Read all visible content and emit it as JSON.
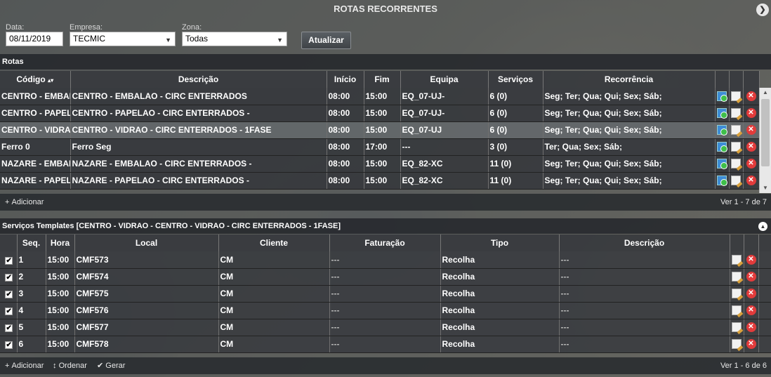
{
  "title": "ROTAS RECORRENTES",
  "filters": {
    "date_label": "Data:",
    "date_value": "08/11/2019",
    "company_label": "Empresa:",
    "company_value": "TECMIC",
    "zone_label": "Zona:",
    "zone_value": "Todas",
    "update_button": "Atualizar"
  },
  "routes": {
    "section_title": "Rotas",
    "columns": [
      "Código",
      "Descrição",
      "Início",
      "Fim",
      "Equipa",
      "Serviços",
      "Recorrência"
    ],
    "sort_indicator": "▴▾",
    "rows": [
      {
        "code": "CENTRO - EMBALAO",
        "desc": "CENTRO - EMBALAO - CIRC ENTERRADOS",
        "start": "08:00",
        "end": "15:00",
        "team": "EQ_07-UJ-",
        "services": "6 (0)",
        "recurrence": "Seg; Ter; Qua; Qui; Sex; Sáb;"
      },
      {
        "code": "CENTRO - PAPELAO",
        "desc": "CENTRO - PAPELAO - CIRC ENTERRADOS -",
        "start": "08:00",
        "end": "15:00",
        "team": "EQ_07-UJ-",
        "services": "6 (0)",
        "recurrence": "Seg; Ter; Qua; Qui; Sex; Sáb;"
      },
      {
        "code": "CENTRO - VIDRAO",
        "desc": "CENTRO - VIDRAO - CIRC ENTERRADOS - 1FASE",
        "start": "08:00",
        "end": "15:00",
        "team": "EQ_07-UJ",
        "services": "6 (0)",
        "recurrence": "Seg; Ter; Qua; Qui; Sex; Sáb;"
      },
      {
        "code": "Ferro 0",
        "desc": "Ferro Seg",
        "start": "08:00",
        "end": "17:00",
        "team": "---",
        "services": "3 (0)",
        "recurrence": "Ter; Qua; Sex; Sáb;"
      },
      {
        "code": "NAZARE - EMBALAO",
        "desc": "NAZARE - EMBALAO - CIRC ENTERRADOS -",
        "start": "08:00",
        "end": "15:00",
        "team": "EQ_82-XC",
        "services": "11 (0)",
        "recurrence": "Seg; Ter; Qua; Qui; Sex; Sáb;"
      },
      {
        "code": "NAZARE - PAPELAO",
        "desc": "NAZARE - PAPELAO - CIRC ENTERRADOS -",
        "start": "08:00",
        "end": "15:00",
        "team": "EQ_82-XC",
        "services": "11 (0)",
        "recurrence": "Seg; Ter; Qua; Qui; Sex; Sáb;"
      }
    ],
    "footer_add": "Adicionar",
    "pager": "Ver 1 - 7 de 7"
  },
  "services": {
    "section_title": "Serviços Templates [CENTRO - VIDRAO - CENTRO - VIDRAO - CIRC ENTERRADOS - 1FASE]",
    "columns": [
      "Seq.",
      "Hora",
      "Local",
      "Cliente",
      "Faturação",
      "Tipo",
      "Descrição"
    ],
    "rows": [
      {
        "seq": "1",
        "time": "15:00",
        "local": "CMF573",
        "client": "CM",
        "billing": "---",
        "type": "Recolha",
        "desc": "---"
      },
      {
        "seq": "2",
        "time": "15:00",
        "local": "CMF574",
        "client": "CM",
        "billing": "---",
        "type": "Recolha",
        "desc": "---"
      },
      {
        "seq": "3",
        "time": "15:00",
        "local": "CMF575",
        "client": "CM",
        "billing": "---",
        "type": "Recolha",
        "desc": "---"
      },
      {
        "seq": "4",
        "time": "15:00",
        "local": "CMF576",
        "client": "CM",
        "billing": "---",
        "type": "Recolha",
        "desc": "---"
      },
      {
        "seq": "5",
        "time": "15:00",
        "local": "CMF577",
        "client": "CM",
        "billing": "---",
        "type": "Recolha",
        "desc": "---"
      },
      {
        "seq": "6",
        "time": "15:00",
        "local": "CMF578",
        "client": "CM",
        "billing": "---",
        "type": "Recolha",
        "desc": "---"
      }
    ],
    "footer_add": "Adicionar",
    "footer_order": "Ordenar",
    "footer_generate": "Gerar",
    "pager": "Ver 1 - 6 de 6"
  }
}
